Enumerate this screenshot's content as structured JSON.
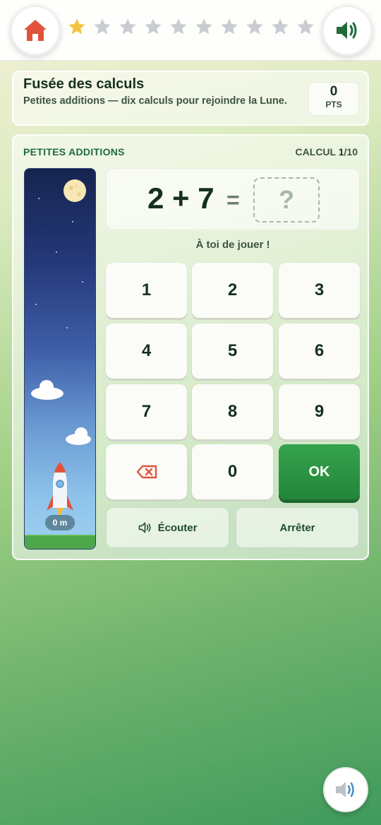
{
  "header": {
    "stars_total": 10,
    "stars_earned": 1
  },
  "game": {
    "title": "Fusée des calculs",
    "subtitle": "Petites additions — dix calculs pour rejoindre la Lune.",
    "score_value": "0",
    "score_unit": "PTS",
    "level_label": "PETITES ADDITIONS",
    "progress_prefix": "CALCUL ",
    "progress_current": "1",
    "progress_total": "/10",
    "altitude": "0 m"
  },
  "equation": {
    "expression": "2 + 7",
    "equals": "=",
    "answer_placeholder": "?",
    "prompt": "À toi de jouer !"
  },
  "keypad": {
    "k1": "1",
    "k2": "2",
    "k3": "3",
    "k4": "4",
    "k5": "5",
    "k6": "6",
    "k7": "7",
    "k8": "8",
    "k9": "9",
    "k0": "0",
    "ok": "OK"
  },
  "actions": {
    "listen": "Écouter",
    "stop": "Arrêter"
  },
  "colors": {
    "accent": "#23863a",
    "home_icon": "#e0533a",
    "star_on": "#f4c542",
    "star_off": "#c9ccd0"
  },
  "icons": [
    "home-icon",
    "speaker-icon",
    "star-icon",
    "moon-icon",
    "cloud-icon",
    "rocket-icon",
    "backspace-icon"
  ]
}
